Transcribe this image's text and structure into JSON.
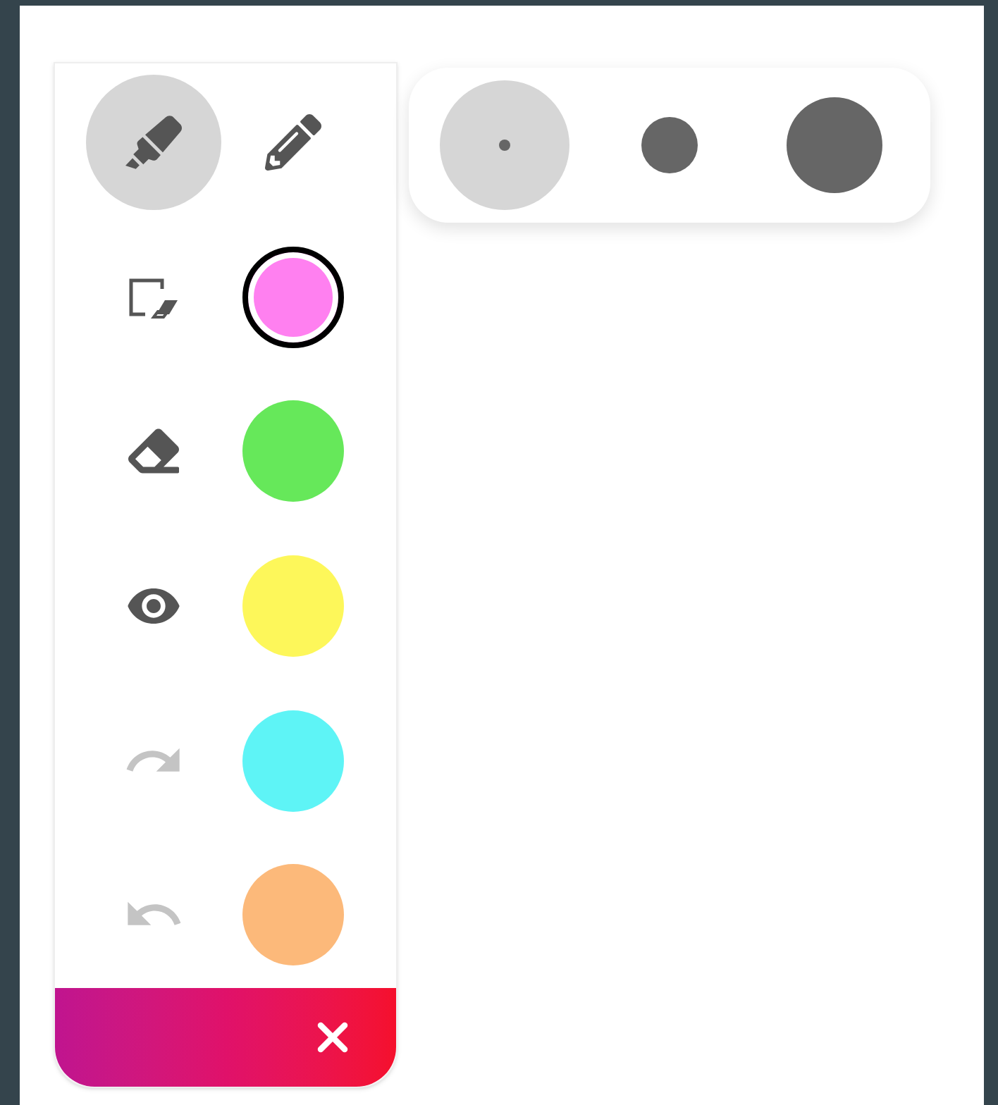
{
  "pen_types": [
    {
      "kind": "highlighter",
      "selected": true
    },
    {
      "kind": "pencil",
      "selected": false
    }
  ],
  "tools": [
    {
      "kind": "clear",
      "disabled": false
    },
    {
      "kind": "eraser",
      "disabled": false
    },
    {
      "kind": "eye",
      "disabled": false
    },
    {
      "kind": "redo",
      "disabled": true
    },
    {
      "kind": "undo",
      "disabled": true
    }
  ],
  "colors": [
    {
      "color": "#ff80f0",
      "selected": true
    },
    {
      "color": "#66e85a",
      "selected": false
    },
    {
      "color": "#fdf75a",
      "selected": false
    },
    {
      "color": "#5ef4f6",
      "selected": false
    },
    {
      "color": "#fcb97a",
      "selected": false
    }
  ],
  "sizes": [
    {
      "kind": "small",
      "selected": true
    },
    {
      "kind": "medium",
      "selected": false
    },
    {
      "kind": "large",
      "selected": false
    }
  ],
  "close_button": {
    "kind": "close"
  }
}
